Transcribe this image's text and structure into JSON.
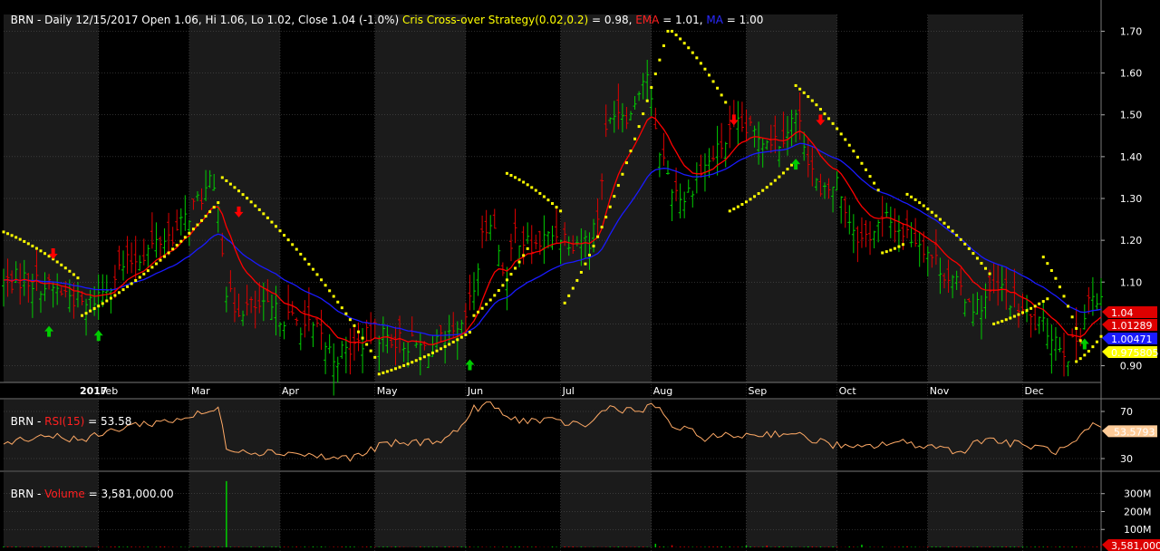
{
  "header": {
    "price": {
      "symbol": "BRN",
      "info": " - Daily 12/15/2017 Open 1.06, Hi 1.06, Lo 1.02, Close 1.04 (-1.0%) ",
      "strategy_label": "Cris Cross-over Strategy(0.02,0.2)",
      "strategy_value": " = 0.98, ",
      "ema_label": "EMA",
      "ema_value": " = 1.01, ",
      "ma_label": "MA",
      "ma_value": " = 1.00"
    },
    "rsi": {
      "symbol": "BRN",
      "sep": " - ",
      "label": "RSI(15)",
      "value": " = 53.58"
    },
    "volume": {
      "symbol": "BRN",
      "sep": " - ",
      "label": "Volume",
      "value": " = 3,581,000.00"
    }
  },
  "colors": {
    "background": "#000000",
    "band": "#1b1b1b",
    "grid": "#5a5a5a",
    "up_bar": "#00cc00",
    "down_bar": "#dd0000",
    "sar": "#ffff00",
    "ema": "#ff0000",
    "ma": "#1a1aff",
    "rsi": "#ffaa66",
    "buy_arrow": "#00cc00",
    "sell_arrow": "#ff0000"
  },
  "chart_data": [
    {
      "type": "ohlc",
      "title": "BRN - Daily 12/15/2017 Open 1.06, Hi 1.06, Lo 1.02, Close 1.04 (-1.0%)",
      "x_axis_labels": [
        "2017",
        "Feb",
        "Mar",
        "Apr",
        "May",
        "Jun",
        "Jul",
        "Aug",
        "Sep",
        "Oct",
        "Nov",
        "Dec"
      ],
      "x_range": [
        -10,
        256
      ],
      "ylim": [
        0.86,
        1.74
      ],
      "y_ticks": [
        0.9,
        1.0,
        1.1,
        1.2,
        1.3,
        1.4,
        1.5,
        1.6,
        1.7
      ],
      "y_tick_labels": [
        "0.90",
        "",
        "1.10",
        "1.20",
        "1.30",
        "1.40",
        "1.50",
        "1.60",
        "1.70"
      ],
      "last_value_labels": [
        {
          "text": "1.04",
          "value": 1.04,
          "color": "#dd0000"
        },
        {
          "text": "1.01289",
          "value": 1.01289,
          "color": "#dd0000"
        },
        {
          "text": "1.00471",
          "value": 1.00471,
          "color": "#1a1aff"
        },
        {
          "text": "0.975805",
          "value": 0.975805,
          "color": "#ffff00"
        }
      ],
      "anchors": [
        [
          -10,
          1.1
        ],
        [
          -5,
          1.11
        ],
        [
          0,
          1.09
        ],
        [
          6,
          1.07
        ],
        [
          10,
          1.04
        ],
        [
          14,
          1.08
        ],
        [
          18,
          1.13
        ],
        [
          24,
          1.17
        ],
        [
          28,
          1.2
        ],
        [
          32,
          1.22
        ],
        [
          36,
          1.28
        ],
        [
          40,
          1.33
        ],
        [
          42,
          1.3
        ],
        [
          44,
          1.08
        ],
        [
          46,
          1.04
        ],
        [
          50,
          1.04
        ],
        [
          55,
          1.03
        ],
        [
          60,
          1.01
        ],
        [
          66,
          0.98
        ],
        [
          70,
          0.92
        ],
        [
          74,
          0.94
        ],
        [
          80,
          0.98
        ],
        [
          86,
          0.96
        ],
        [
          92,
          0.94
        ],
        [
          98,
          0.96
        ],
        [
          101,
          0.98
        ],
        [
          104,
          1.08
        ],
        [
          106,
          1.2
        ],
        [
          108,
          1.26
        ],
        [
          112,
          1.1
        ],
        [
          114,
          1.22
        ],
        [
          118,
          1.18
        ],
        [
          124,
          1.22
        ],
        [
          128,
          1.2
        ],
        [
          132,
          1.2
        ],
        [
          134,
          1.26
        ],
        [
          136,
          1.45
        ],
        [
          138,
          1.52
        ],
        [
          142,
          1.5
        ],
        [
          144,
          1.57
        ],
        [
          146,
          1.6
        ],
        [
          148,
          1.45
        ],
        [
          152,
          1.33
        ],
        [
          155,
          1.3
        ],
        [
          158,
          1.35
        ],
        [
          162,
          1.4
        ],
        [
          166,
          1.45
        ],
        [
          168,
          1.47
        ],
        [
          174,
          1.45
        ],
        [
          178,
          1.44
        ],
        [
          182,
          1.5
        ],
        [
          184,
          1.44
        ],
        [
          188,
          1.3
        ],
        [
          192,
          1.34
        ],
        [
          195,
          1.25
        ],
        [
          198,
          1.2
        ],
        [
          204,
          1.25
        ],
        [
          208,
          1.22
        ],
        [
          212,
          1.2
        ],
        [
          216,
          1.15
        ],
        [
          220,
          1.1
        ],
        [
          226,
          1.04
        ],
        [
          228,
          1.06
        ],
        [
          232,
          1.08
        ],
        [
          236,
          1.04
        ],
        [
          240,
          1.0
        ],
        [
          244,
          0.98
        ],
        [
          248,
          0.93
        ],
        [
          251,
          0.98
        ],
        [
          253,
          1.06
        ],
        [
          256,
          1.04
        ]
      ],
      "sar_runs": [
        {
          "x": [
            -10,
            8
          ],
          "y": [
            1.22,
            1.11
          ]
        },
        {
          "x": [
            9,
            42
          ],
          "y": [
            1.02,
            1.29
          ]
        },
        {
          "x": [
            43,
            80
          ],
          "y": [
            1.35,
            0.92
          ]
        },
        {
          "x": [
            81,
            103
          ],
          "y": [
            0.88,
            0.98
          ]
        },
        {
          "x": [
            104,
            117
          ],
          "y": [
            1.02,
            1.18
          ]
        },
        {
          "x": [
            112,
            125
          ],
          "y": [
            1.36,
            1.27
          ]
        },
        {
          "x": [
            126,
            151
          ],
          "y": [
            1.05,
            1.7
          ]
        },
        {
          "x": [
            152,
            165
          ],
          "y": [
            1.7,
            1.53
          ]
        },
        {
          "x": [
            166,
            181
          ],
          "y": [
            1.27,
            1.38
          ]
        },
        {
          "x": [
            182,
            202
          ],
          "y": [
            1.57,
            1.32
          ]
        },
        {
          "x": [
            203,
            208
          ],
          "y": [
            1.17,
            1.19
          ]
        },
        {
          "x": [
            209,
            229
          ],
          "y": [
            1.31,
            1.12
          ]
        },
        {
          "x": [
            230,
            243
          ],
          "y": [
            1.0,
            1.06
          ]
        },
        {
          "x": [
            242,
            251
          ],
          "y": [
            1.16,
            0.96
          ]
        },
        {
          "x": [
            250,
            256
          ],
          "y": [
            0.91,
            0.97
          ]
        }
      ],
      "arrows": [
        {
          "x": 1,
          "dir": "up",
          "value": 0.98
        },
        {
          "x": 2,
          "dir": "down",
          "value": 1.17
        },
        {
          "x": 13,
          "dir": "up",
          "value": 0.97
        },
        {
          "x": 47,
          "dir": "down",
          "value": 1.27
        },
        {
          "x": 103,
          "dir": "up",
          "value": 0.9
        },
        {
          "x": 167,
          "dir": "down",
          "value": 1.49
        },
        {
          "x": 182,
          "dir": "up",
          "value": 1.38
        },
        {
          "x": 188,
          "dir": "down",
          "value": 1.49
        },
        {
          "x": 252,
          "dir": "up",
          "value": 0.95
        }
      ]
    },
    {
      "type": "line",
      "title": "BRN - RSI(15) = 53.58",
      "ylim": [
        20,
        80
      ],
      "y_ticks": [
        30,
        70
      ],
      "y_tick_labels": [
        "30",
        "70"
      ],
      "last_value_label": {
        "text": "53.5793",
        "value": 53.5793
      },
      "anchors": [
        [
          -10,
          44
        ],
        [
          0,
          50
        ],
        [
          10,
          46
        ],
        [
          20,
          58
        ],
        [
          30,
          62
        ],
        [
          38,
          68
        ],
        [
          42,
          72
        ],
        [
          44,
          40
        ],
        [
          50,
          36
        ],
        [
          60,
          35
        ],
        [
          70,
          30
        ],
        [
          76,
          32
        ],
        [
          82,
          42
        ],
        [
          92,
          44
        ],
        [
          98,
          48
        ],
        [
          102,
          62
        ],
        [
          104,
          72
        ],
        [
          108,
          78
        ],
        [
          112,
          64
        ],
        [
          120,
          62
        ],
        [
          128,
          60
        ],
        [
          132,
          58
        ],
        [
          136,
          74
        ],
        [
          144,
          70
        ],
        [
          148,
          75
        ],
        [
          152,
          58
        ],
        [
          160,
          48
        ],
        [
          170,
          50
        ],
        [
          180,
          52
        ],
        [
          186,
          46
        ],
        [
          196,
          38
        ],
        [
          206,
          44
        ],
        [
          216,
          40
        ],
        [
          222,
          36
        ],
        [
          228,
          48
        ],
        [
          232,
          44
        ],
        [
          240,
          40
        ],
        [
          246,
          36
        ],
        [
          250,
          44
        ],
        [
          254,
          58
        ],
        [
          256,
          54
        ]
      ]
    },
    {
      "type": "bar",
      "title": "BRN - Volume = 3,581,000.00",
      "ylim": [
        0,
        420
      ],
      "y_ticks": [
        100,
        200,
        300
      ],
      "y_tick_labels": [
        "100M",
        "200M",
        "300M"
      ],
      "last_value_label": {
        "text": "3,581,000",
        "value": 3.581
      },
      "spikes": [
        [
          44,
          370
        ],
        [
          148,
          20
        ],
        [
          152,
          12
        ],
        [
          170,
          10
        ],
        [
          175,
          10
        ],
        [
          198,
          15
        ],
        [
          209,
          6
        ]
      ]
    }
  ]
}
